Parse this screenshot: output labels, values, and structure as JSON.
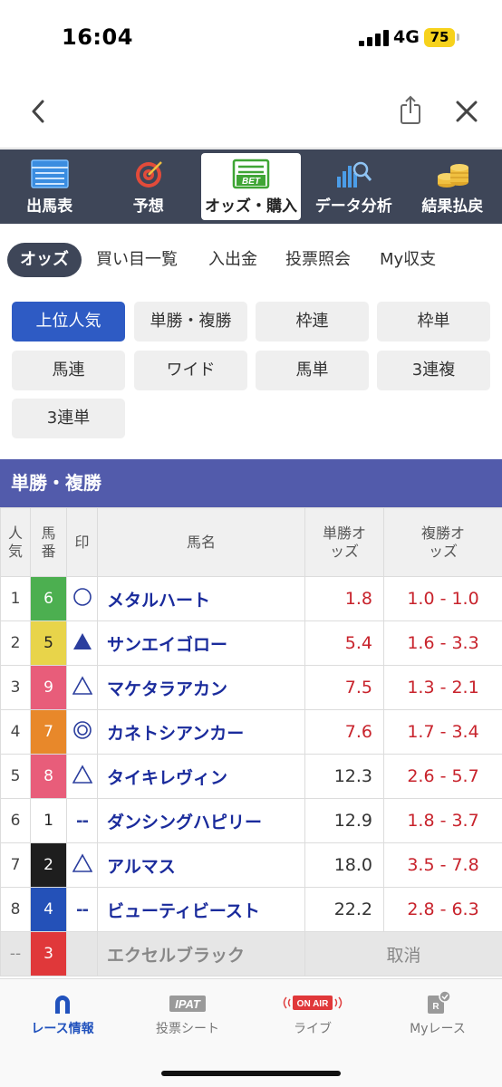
{
  "status_bar": {
    "time": "16:04",
    "network": "4G",
    "battery": "75"
  },
  "main_tabs": [
    {
      "label": "出馬表",
      "icon": "race-card-icon"
    },
    {
      "label": "予想",
      "icon": "target-icon"
    },
    {
      "label": "オッズ・購入",
      "icon": "bet-icon"
    },
    {
      "label": "データ分析",
      "icon": "chart-search-icon"
    },
    {
      "label": "結果払戻",
      "icon": "coins-icon"
    }
  ],
  "bet_icon_text": "BET",
  "sub_tabs": [
    "オッズ",
    "買い目一覧",
    "入出金",
    "投票照会",
    "My収支"
  ],
  "bet_types": [
    "上位人気",
    "単勝・複勝",
    "枠連",
    "枠単",
    "馬連",
    "ワイド",
    "馬単",
    "3連複",
    "3連単"
  ],
  "section_title": "単勝・複勝",
  "table_headers": {
    "popularity": "人気",
    "horse_number": "馬番",
    "mark": "印",
    "horse_name": "馬名",
    "win_odds": "単勝オッズ",
    "place_odds": "複勝オッズ"
  },
  "rows": [
    {
      "pop": "1",
      "num": "6",
      "mark": "◯",
      "name": "メタルハート",
      "win": "1.8",
      "place": "1.0 - 1.0"
    },
    {
      "pop": "2",
      "num": "5",
      "mark": "▲",
      "name": "サンエイゴロー",
      "win": "5.4",
      "place": "1.6 - 3.3"
    },
    {
      "pop": "3",
      "num": "9",
      "mark": "△",
      "name": "マケタラアカン",
      "win": "7.5",
      "place": "1.3 - 2.1"
    },
    {
      "pop": "4",
      "num": "7",
      "mark": "◎",
      "name": "カネトシアンカー",
      "win": "7.6",
      "place": "1.7 - 3.4"
    },
    {
      "pop": "5",
      "num": "8",
      "mark": "△",
      "name": "タイキレヴィン",
      "win": "12.3",
      "place": "2.6 - 5.7"
    },
    {
      "pop": "6",
      "num": "1",
      "mark": "--",
      "name": "ダンシングハピリー",
      "win": "12.9",
      "place": "1.8 - 3.7"
    },
    {
      "pop": "7",
      "num": "2",
      "mark": "△",
      "name": "アルマス",
      "win": "18.0",
      "place": "3.5 - 7.8"
    },
    {
      "pop": "8",
      "num": "4",
      "mark": "--",
      "name": "ビューティビースト",
      "win": "22.2",
      "place": "2.8 - 6.3"
    }
  ],
  "scratched_row": {
    "pop": "--",
    "num": "3",
    "name": "エクセルブラック",
    "status": "取消"
  },
  "colors": {
    "num_6": "#4caf50",
    "num_5": "#e8d44a",
    "num_9": "#e85d7a",
    "num_7": "#e8882a",
    "num_8": "#e85d7a",
    "num_1": "#ffffff",
    "num_2": "#1e1e1e",
    "num_4": "#2451b8",
    "num_3": "#e0383a",
    "header_bar": "#3e4658",
    "section": "#525bab",
    "accent_blue": "#2e5bc4",
    "odds_red": "#c8232c"
  },
  "bottom_tabs": [
    {
      "label": "レース情報",
      "icon": "horseshoe-icon"
    },
    {
      "label": "投票シート",
      "icon": "ipat-icon"
    },
    {
      "label": "ライブ",
      "icon": "on-air-icon"
    },
    {
      "label": "Myレース",
      "icon": "my-race-icon"
    }
  ],
  "ipat_text": "IPAT",
  "on_air_text": "ON AIR"
}
